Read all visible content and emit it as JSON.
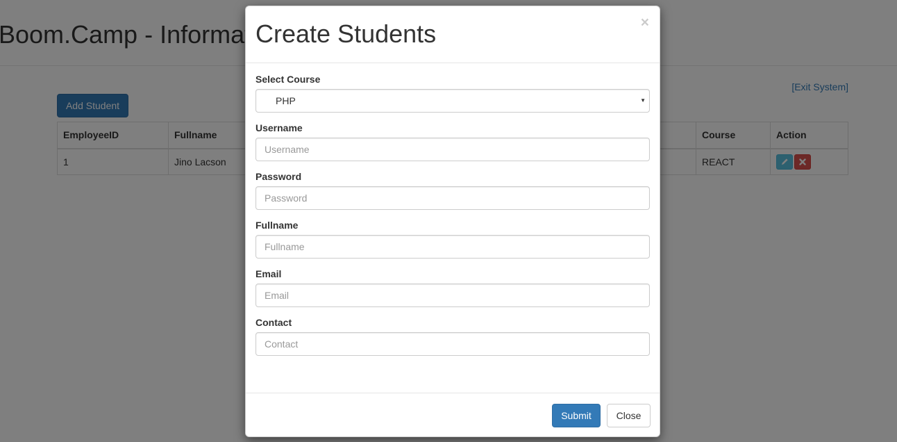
{
  "page": {
    "title": "Boom.Camp - Information System",
    "exit_link": "[Exit System]",
    "add_button": "Add Student"
  },
  "table": {
    "headers": {
      "id": "EmployeeID",
      "fullname": "Fullname",
      "course": "Course",
      "action": "Action"
    },
    "rows": [
      {
        "id": "1",
        "fullname": "Jino Lacson",
        "course": "REACT"
      }
    ]
  },
  "modal": {
    "title": "Create Students",
    "close_symbol": "×",
    "fields": {
      "course": {
        "label": "Select Course",
        "value": "PHP"
      },
      "username": {
        "label": "Username",
        "placeholder": "Username"
      },
      "password": {
        "label": "Password",
        "placeholder": "Password"
      },
      "fullname": {
        "label": "Fullname",
        "placeholder": "Fullname"
      },
      "email": {
        "label": "Email",
        "placeholder": "Email"
      },
      "contact": {
        "label": "Contact",
        "placeholder": "Contact"
      }
    },
    "submit_label": "Submit",
    "close_label": "Close"
  },
  "icons": {
    "edit": "pencil-icon",
    "delete": "remove-icon",
    "caret": "chevron-down-icon"
  },
  "colors": {
    "primary": "#337ab7",
    "info": "#5bc0de",
    "danger": "#d9534f",
    "backdrop": "rgba(0,0,0,0.5)"
  }
}
